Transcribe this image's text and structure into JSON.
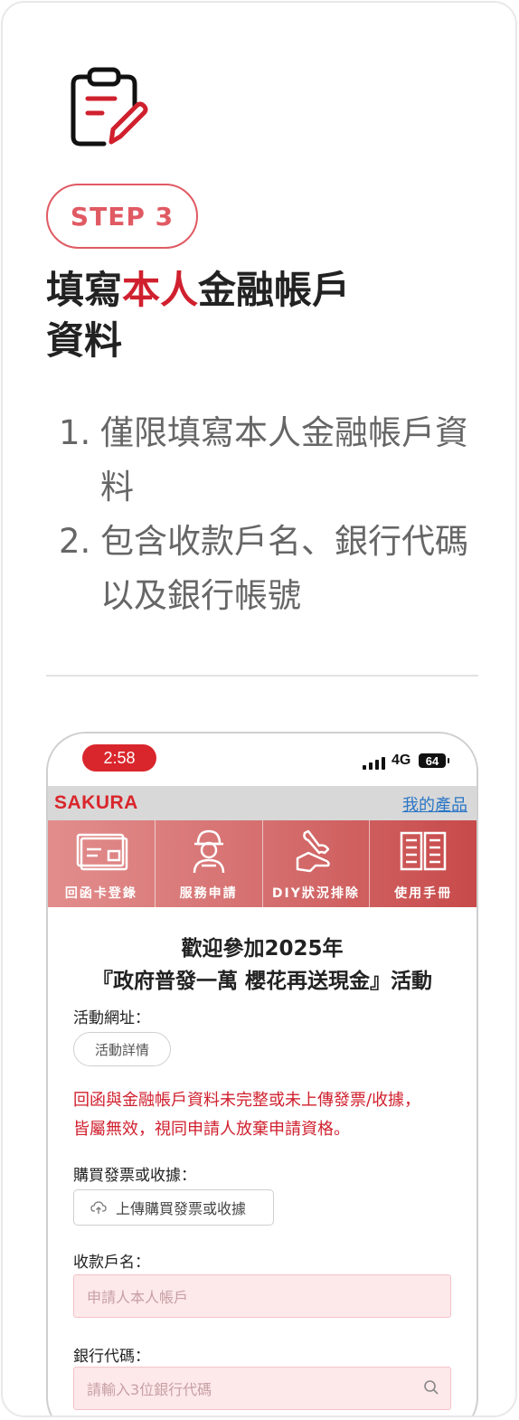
{
  "step": {
    "label": "STEP 3"
  },
  "headline": {
    "part1": "填寫",
    "highlight": "本人",
    "part2": "金融帳戶",
    "line2": "資料"
  },
  "steps": [
    {
      "num": "1.",
      "text": "僅限填寫本人金融帳戶資料"
    },
    {
      "num": "2.",
      "text": "包含收款戶名、銀行代碼以及銀行帳號"
    }
  ],
  "phone": {
    "status": {
      "time": "2:58",
      "network": "4G",
      "battery": "64"
    },
    "brand": "SAKURA",
    "my_products": "我的產品",
    "nav": [
      {
        "label": "回函卡登錄",
        "icon": "envelope-card-icon"
      },
      {
        "label": "服務申請",
        "icon": "technician-icon"
      },
      {
        "label": "DIY狀況排除",
        "icon": "wrench-hand-icon"
      },
      {
        "label": "使用手冊",
        "icon": "open-book-icon"
      }
    ],
    "welcome_line1": "歡迎參加2025年",
    "welcome_line2": "『政府普發一萬 櫻花再送現金』活動",
    "activity_url_label": "活動網址：",
    "activity_details_btn": "活動詳情",
    "warning": "回函與金融帳戶資料未完整或未上傳發票/收據，皆屬無效，視同申請人放棄申請資格。",
    "invoice_label": "購買發票或收據：",
    "upload_btn": "上傳購買發票或收據",
    "payee_label": "收款戶名：",
    "payee_placeholder": "申請人本人帳戶",
    "bank_code_label": "銀行代碼：",
    "bank_code_placeholder": "請輸入3位銀行代碼"
  },
  "colors": {
    "accent_red": "#d0202e",
    "pill_border": "#e05a63",
    "nav_gradient_start": "#e28d8d",
    "nav_gradient_end": "#c84a4a",
    "input_bg": "#fde8ea",
    "link_blue": "#2a76c6"
  }
}
